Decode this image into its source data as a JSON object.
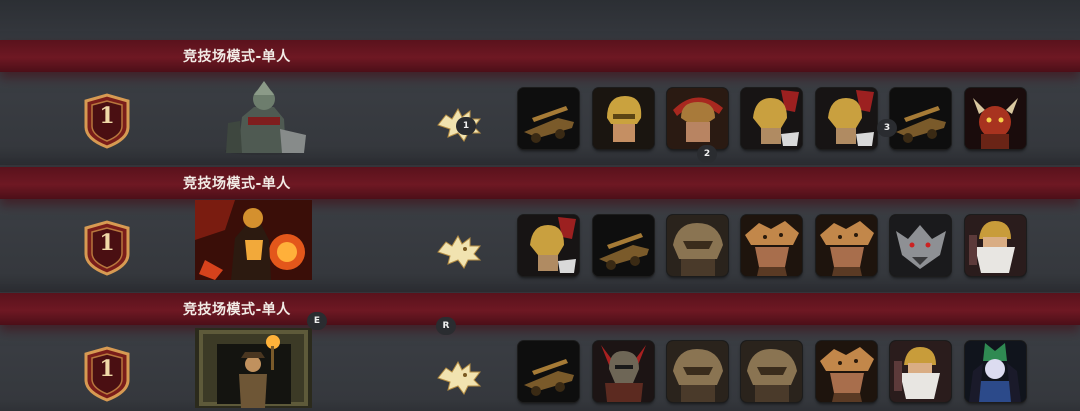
{
  "rows": [
    {
      "title": "竞技场模式-单人",
      "rank": "1",
      "hero": "warlord-hero",
      "faction_icon": "wolf-emblem-icon",
      "units": [
        "ballista-icon",
        "gold-helmet-warrior-icon",
        "crimson-crest-gladiator-icon",
        "winged-helm-knight-icon",
        "winged-helm-knight-icon",
        "ballista-icon",
        "horned-demon-icon"
      ]
    },
    {
      "title": "竞技场模式-单人",
      "rank": "1",
      "hero": "fire-forge-hero",
      "faction_icon": "wolf-emblem-icon",
      "units": [
        "winged-helm-knight-icon",
        "ballista-icon",
        "bronze-helm-beast-icon",
        "wolf-pelt-warrior-icon",
        "wolf-pelt-warrior-icon",
        "werewolf-icon",
        "dwarf-elder-icon"
      ]
    },
    {
      "title": "竞技场模式-单人",
      "rank": "1",
      "hero": "torch-explorer-hero",
      "faction_icon": "wolf-emblem-icon",
      "units": [
        "ballista-icon",
        "horned-helm-warrior-icon",
        "bronze-helm-beast-icon",
        "bronze-helm-beast-icon",
        "wolf-pelt-warrior-icon",
        "dwarf-elder-icon",
        "jade-queen-icon"
      ]
    }
  ],
  "markers": {
    "m1": "1",
    "m2": "2",
    "m3": "3",
    "mE": "E",
    "mR": "R"
  }
}
